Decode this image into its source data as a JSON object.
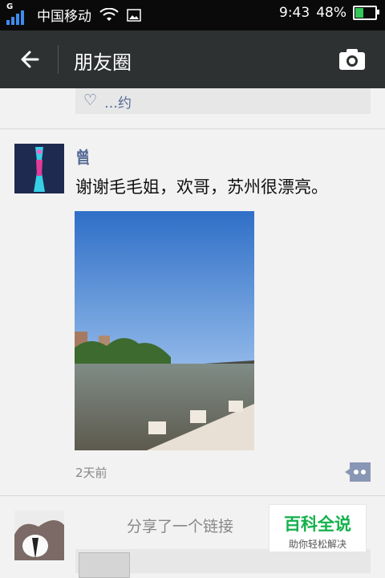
{
  "status_bar": {
    "carrier": "中国移动",
    "network_type": "G",
    "time": "9:43",
    "battery_percent": "48%",
    "battery_level": 0.48,
    "icons": [
      "signal-icon",
      "wifi-icon",
      "image-icon",
      "battery-icon"
    ]
  },
  "nav": {
    "title": "朋友圈",
    "back_icon": "arrow-left-icon",
    "camera_icon": "camera-icon"
  },
  "colors": {
    "nav_bg": "#2e3132",
    "link_blue": "#576b95",
    "brand_green": "#14b14b"
  },
  "posts": [
    {
      "likes_text": "…约"
    },
    {
      "author": "曾…",
      "text": "谢谢毛毛姐，欢哥，苏州很漂亮。",
      "time": "2天前",
      "comment_icon": "more-dots-icon"
    },
    {
      "author": "…",
      "text": "分享了一个链接"
    }
  ],
  "watermark": {
    "title": "百科全说",
    "subtitle": "助你轻松解决"
  }
}
